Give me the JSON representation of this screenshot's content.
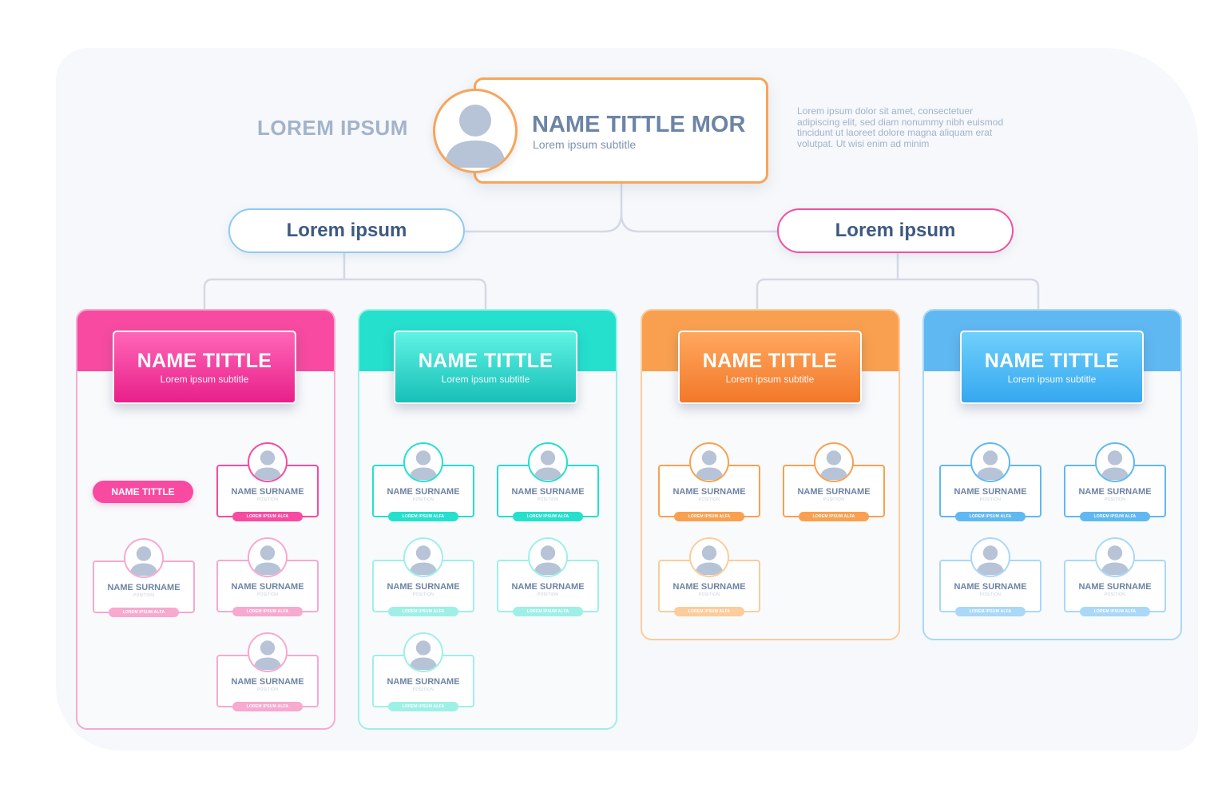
{
  "header": {
    "left_title": "LOREM IPSUM",
    "paragraph": "Lorem ipsum dolor sit amet, consectetuer adipiscing elit, sed diam nonummy nibh euismod tincidunt ut laoreet dolore magna aliquam erat volutpat. Ut wisi enim ad minim"
  },
  "top": {
    "name": "NAME TITTLE MOR",
    "subtitle": "Lorem ipsum subtitle",
    "icon": "user-avatar-icon"
  },
  "branches": [
    {
      "label": "Lorem ipsum",
      "color": "#8ecaf2"
    },
    {
      "label": "Lorem ipsum",
      "color": "#f24fa0"
    }
  ],
  "departments": [
    {
      "title": "NAME TITTLE",
      "subtitle": "Lorem ipsum subtitle",
      "accent": "#f74aa0",
      "light": "#f7a9cf",
      "gradient": [
        "#ff66b8",
        "#e8208a"
      ]
    },
    {
      "title": "NAME TITTLE",
      "subtitle": "Lorem ipsum subtitle",
      "accent": "#24e0cc",
      "light": "#9ef0e6",
      "gradient": [
        "#5ff3e3",
        "#18bfb8"
      ]
    },
    {
      "title": "NAME TITTLE",
      "subtitle": "Lorem ipsum subtitle",
      "accent": "#f9a050",
      "light": "#fbcc9c",
      "gradient": [
        "#ffa85e",
        "#f2782a"
      ]
    },
    {
      "title": "NAME TITTLE",
      "subtitle": "Lorem ipsum subtitle",
      "accent": "#60b8f2",
      "light": "#aad8f7",
      "gradient": [
        "#6fd0fb",
        "#36a8f0"
      ]
    }
  ],
  "sub_title_pill": "NAME TITTLE",
  "person": {
    "name": "NAME SURNAME",
    "position": "POSITION",
    "badge": "LOREM IPSUM ALFA"
  }
}
